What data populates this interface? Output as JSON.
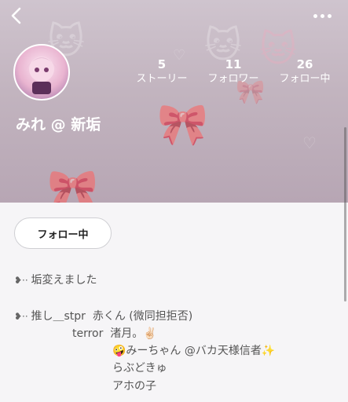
{
  "header": {
    "back_icon": "chevron-left-icon",
    "more_icon": "ellipsis-horizontal-icon"
  },
  "profile": {
    "name": "みれ @ 新垢",
    "stats": [
      {
        "count": "5",
        "label": "ストーリー"
      },
      {
        "count": "11",
        "label": "フォロワー"
      },
      {
        "count": "26",
        "label": "フォロー中"
      }
    ],
    "follow_button": "フォロー中"
  },
  "bio": {
    "line1": "垢変えました",
    "line2_label": "推し＿stpr",
    "line2_value": "赤くん (微同担拒否)",
    "line3_label": "terror",
    "line3_value": "渚月。✌🏻",
    "line4": "🤪みーちゃん @バカ天様信者✨",
    "line5": "らぶどきゅ",
    "line6": "アホの子"
  }
}
